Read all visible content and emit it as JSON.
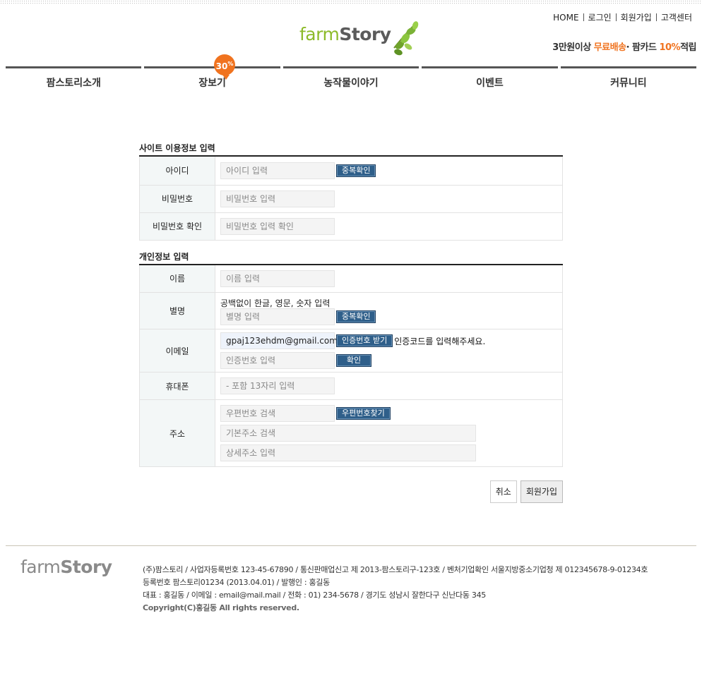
{
  "header": {
    "util_links": [
      "HOME",
      "로그인",
      "회원가입",
      "고객센터"
    ],
    "logo": {
      "farm": "farm",
      "story": "Story"
    },
    "promo": {
      "part1": "3만원이상",
      "free_shipping": "무료배송",
      "part2": "· 팜카드",
      "percent": "10%",
      "part3": "적립"
    },
    "badge": {
      "number": "30",
      "unit": "%"
    }
  },
  "nav": [
    "팜스토리소개",
    "장보기",
    "농작물이야기",
    "이벤트",
    "커뮤니티"
  ],
  "site_info": {
    "title": "사이트 이용정보 입력",
    "id_label": "아이디",
    "id_placeholder": "아이디 입력",
    "id_check_button": "중복확인",
    "pw_label": "비밀번호",
    "pw_placeholder": "비밀번호 입력",
    "pw2_label": "비밀번호 확인",
    "pw2_placeholder": "비밀번호 입력 확인"
  },
  "personal_info": {
    "title": "개인정보 입력",
    "name_label": "이름",
    "name_placeholder": "이름 입력",
    "nick_label": "별명",
    "nick_hint": "공백없이 한글, 영문, 숫자 입력",
    "nick_placeholder": "별명 입력",
    "nick_check_button": "중복확인",
    "email_label": "이메일",
    "email_value": "gpaj123ehdm@gmail.com",
    "email_send_button": "인증번호 받기",
    "email_hint": "인증코드를 입력해주세요.",
    "auth_placeholder": "인증번호 입력",
    "auth_confirm_button": "확인",
    "phone_label": "휴대폰",
    "phone_placeholder": "- 포함 13자리 입력",
    "addr_label": "주소",
    "zip_placeholder": "우편번호 검색",
    "zip_button": "우편번호찾기",
    "addr1_placeholder": "기본주소 검색",
    "addr2_placeholder": "상세주소 입력"
  },
  "actions": {
    "cancel": "취소",
    "submit": "회원가입"
  },
  "footer": {
    "logo_farm": "farm",
    "logo_story": "Story",
    "line1": "(주)팜스토리 / 사업자등록번호 123-45-67890 / 통신판매업신고 제 2013-팜스토리구-123호 / 벤처기업확인 서울지방중소기업청 제 012345678-9-01234호",
    "line2": "등록번호 팜스토리01234 (2013.04.01) / 발행인 : 홍길동",
    "line3": "대표 : 홍길동 / 이메일 : email@mail.mail / 전화 : 01) 234-5678 / 경기도 성남시 잘한다구 신난다동 345",
    "copyright": "Copyright(C)홍길동 All rights reserved."
  }
}
